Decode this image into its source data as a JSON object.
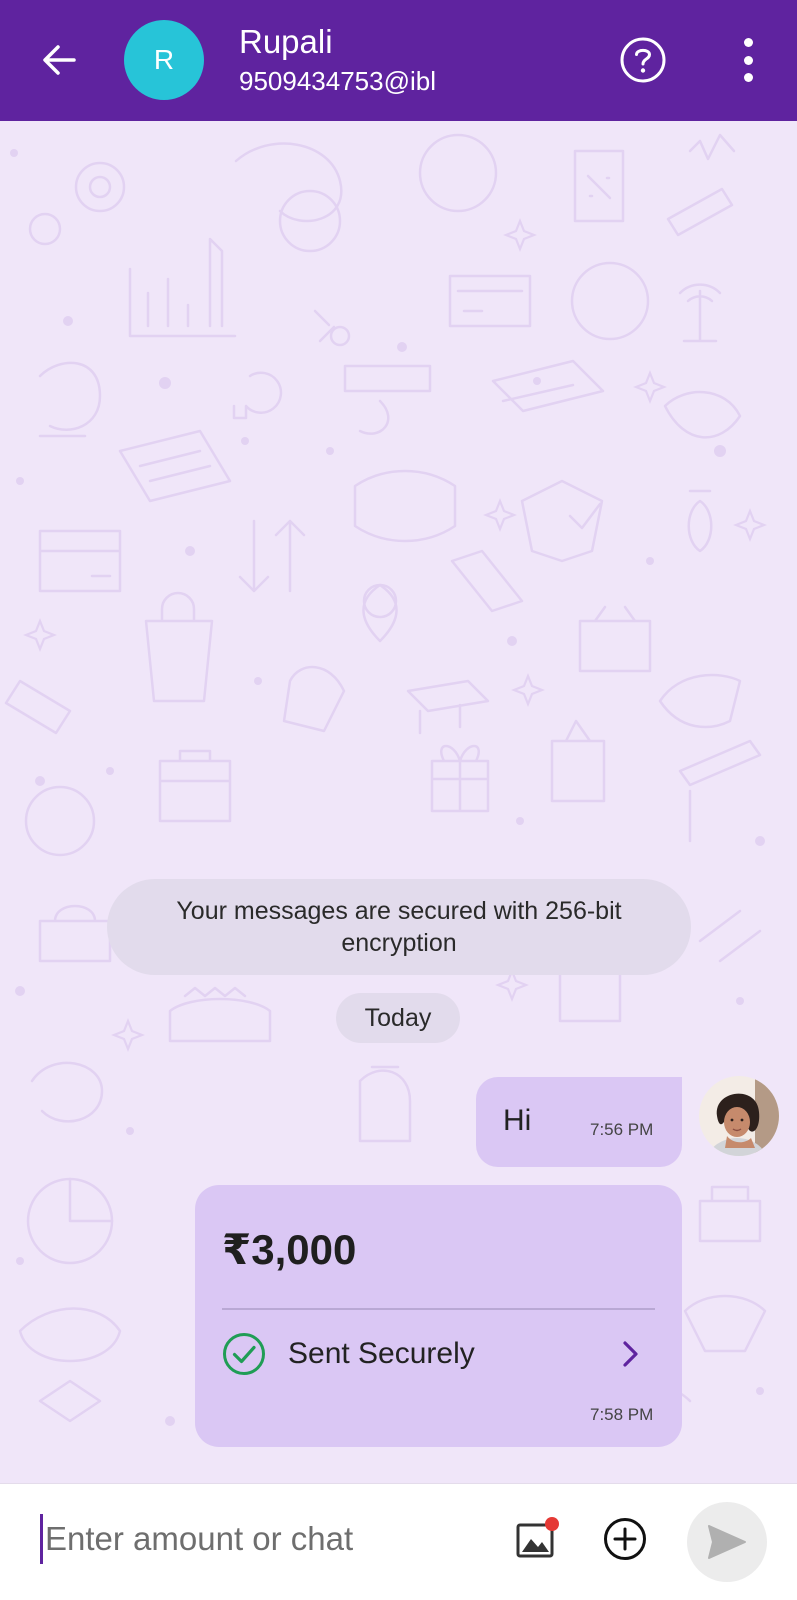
{
  "header": {
    "avatar_letter": "R",
    "contact_name": "Rupali",
    "contact_vpa": "9509434753@ibl",
    "back_icon": "arrow-left-icon",
    "help_icon": "question-circle-icon",
    "more_icon": "vertical-dots-icon"
  },
  "chat": {
    "encryption_notice": "Your messages are secured with 256-bit encryption",
    "date_label": "Today",
    "message": {
      "text": "Hi",
      "time": "7:56 PM"
    },
    "payment": {
      "amount": "₹3,000",
      "status": "Sent Securely",
      "time": "7:58 PM",
      "status_icon": "check-circle-icon"
    }
  },
  "input_bar": {
    "placeholder": "Enter amount or chat",
    "gallery_icon": "image-icon",
    "add_icon": "plus-circle-icon",
    "send_icon": "send-icon"
  },
  "colors": {
    "header": "#5f239f",
    "avatar": "#27c4d8",
    "chat_background": "#f0e6f9",
    "bubble": "#dac7f4",
    "success": "#1f9d55",
    "badge": "#e53935"
  }
}
